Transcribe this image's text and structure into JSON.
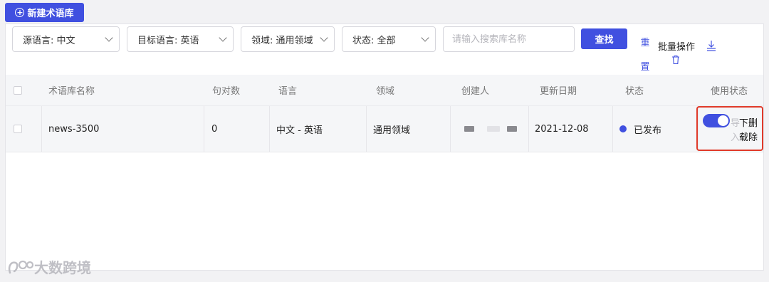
{
  "toolbar": {
    "new_button_label": "新建术语库",
    "filters": {
      "source_lang": "源语言: 中文",
      "target_lang": "目标语言: 英语",
      "domain": "领域: 通用领域",
      "status": "状态: 全部"
    },
    "search_placeholder": "请输入搜索库名称",
    "find_label": "查找",
    "reset_label": "重置",
    "batch_label": "批量操作"
  },
  "table": {
    "columns": [
      "术语库名称",
      "句对数",
      "语言",
      "领域",
      "创建人",
      "更新日期",
      "状态",
      "使用状态"
    ],
    "rows": [
      {
        "name": "news-3500",
        "count": "0",
        "language": "中文 - 英语",
        "domain": "通用领域",
        "creator": "",
        "updated": "2021-12-08",
        "status": "已发布",
        "enabled": true,
        "actions": {
          "export_a": "导",
          "export_b": "入",
          "download_a": "下",
          "download_b": "载",
          "delete_a": "删",
          "delete_b": "除"
        }
      }
    ]
  },
  "colors": {
    "primary": "#4050e0",
    "highlight": "#e03a2a"
  },
  "watermark": "大数跨境"
}
